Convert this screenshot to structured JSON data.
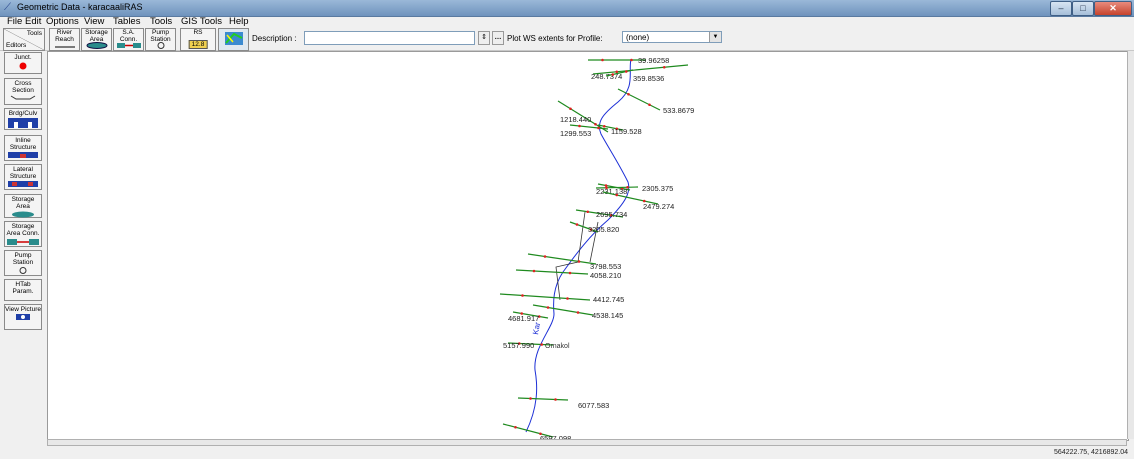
{
  "window": {
    "title": "Geometric Data - karacaaliRAS"
  },
  "menu": [
    "File",
    "Edit",
    "Options",
    "View",
    "Tables",
    "Tools",
    "GIS Tools",
    "Help"
  ],
  "toolbar": {
    "tools_label": "Tools",
    "editors_label": "Editors",
    "river_reach": "River Reach",
    "storage_area": "Storage Area",
    "sa_conn": "S.A. Conn.",
    "pump_station": "Pump Station",
    "rs_label": "RS",
    "rs_badge": "12.8",
    "description_label": "Description :",
    "description_value": "",
    "plot_ws_label": "Plot WS extents for Profile:",
    "profile_value": "(none)"
  },
  "sidebar": [
    {
      "label": "Junct."
    },
    {
      "label": "Cross Section"
    },
    {
      "label": "Brdg/Culv"
    },
    {
      "label": "Inline Structure"
    },
    {
      "label": "Lateral Structure"
    },
    {
      "label": "Storage Area"
    },
    {
      "label": "Storage Area Conn."
    },
    {
      "label": "Pump Station"
    },
    {
      "label": "HTab Param."
    },
    {
      "label": "View Picture"
    }
  ],
  "map": {
    "river_label": "Kar",
    "reach_label": "Ornakol",
    "cross_sections": [
      "39.96258",
      "248.7374",
      "359.8536",
      "533.8679",
      "1218.440",
      "1299.553",
      "1159.528",
      "2231.138",
      "2305.375",
      "2479.274",
      "2695.734",
      "3205.820",
      "3798.553",
      "4058.210",
      "4412.745",
      "4538.145",
      "4681.917",
      "5157.990",
      "6077.583",
      "6597.098"
    ]
  },
  "status": {
    "coordinates": "564222.75, 4216892.04"
  },
  "colors": {
    "river": "#1c2fd6",
    "xs_line": "#1f8a1f",
    "bank_point": "#e02020",
    "titlebar": "#6f93bd"
  }
}
